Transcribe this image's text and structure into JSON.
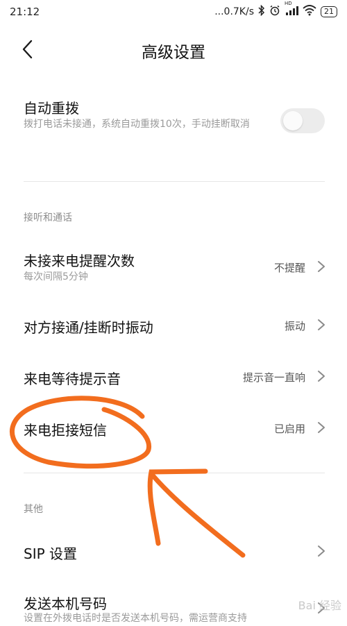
{
  "status_bar": {
    "time": "21:12",
    "net_speed": "...0.7K/s",
    "hd_label": "HD",
    "battery": "21"
  },
  "header": {
    "title": "高级设置"
  },
  "auto_redial": {
    "title": "自动重拨",
    "subtitle": "拨打电话未接通，系统自动重拨10次，手动挂断取消",
    "toggle_on": false
  },
  "section_answer": {
    "header": "接听和通话",
    "items": [
      {
        "title": "未接来电提醒次数",
        "subtitle": "每次间隔5分钟",
        "value": "不提醒"
      },
      {
        "title": "对方接通/挂断时振动",
        "value": "振动"
      },
      {
        "title": "来电等待提示音",
        "value": "提示音一直响"
      },
      {
        "title": "来电拒接短信",
        "value": "已启用"
      }
    ]
  },
  "section_other": {
    "header": "其他",
    "items": [
      {
        "title": "SIP 设置"
      },
      {
        "title": "发送本机号码",
        "subtitle": "设置在外拨电话时是否发送本机号码，需运营商支持"
      }
    ]
  },
  "watermark": "Bai 经验",
  "colors": {
    "annotation": "#f26d1e",
    "toggle_track": "#ececec",
    "secondary_text": "#9a9a9a"
  }
}
